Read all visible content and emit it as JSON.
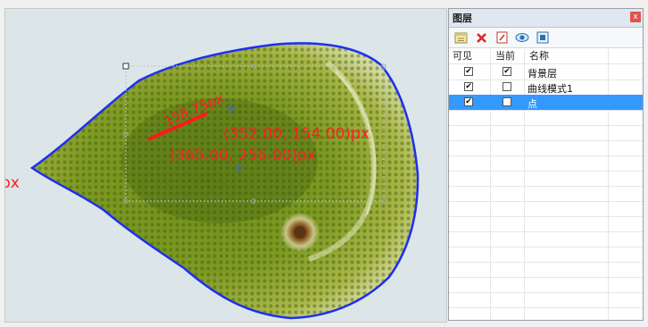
{
  "canvas": {
    "edge_label": "px",
    "label_length": "158.75px",
    "label_pos_a": "(352.00, 154.00)px",
    "label_pos_b": "(365.00, 256.00)px",
    "outline_color": "#1f2ff0",
    "annotation_color": "#ff2020"
  },
  "panel": {
    "title": "图层",
    "close_glyph": "x",
    "toolbar": [
      {
        "icon": "add-layer-icon"
      },
      {
        "icon": "delete-icon"
      },
      {
        "icon": "edit-layer-icon"
      },
      {
        "icon": "visibility-eye-icon"
      },
      {
        "icon": "layer-properties-icon"
      }
    ],
    "columns": {
      "visible": "可见",
      "current": "当前",
      "name": "名称"
    },
    "layers": [
      {
        "name": "背景层",
        "visible": true,
        "current": true,
        "selected": false
      },
      {
        "name": "曲线模式1",
        "visible": true,
        "current": false,
        "selected": false
      },
      {
        "name": "点",
        "visible": true,
        "current": false,
        "selected": true
      }
    ],
    "check_glyph": "✔"
  }
}
